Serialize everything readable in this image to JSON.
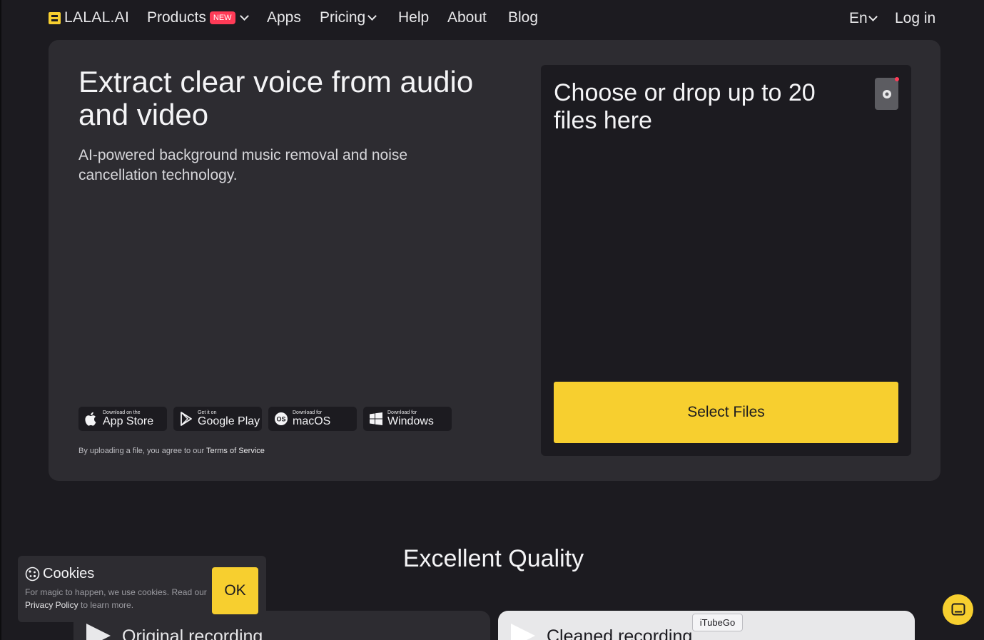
{
  "brand": {
    "name": "LALAL.AI"
  },
  "nav": {
    "products": "Products",
    "new_badge": "NEW",
    "apps": "Apps",
    "pricing": "Pricing",
    "help": "Help",
    "about": "About",
    "blog": "Blog",
    "language": "En",
    "login": "Log in"
  },
  "hero": {
    "title": "Extract clear voice from audio and video",
    "subtitle": "AI-powered background music removal and noise cancellation technology.",
    "stores": [
      {
        "small": "Download on the",
        "big": "App Store",
        "icon": "apple-icon"
      },
      {
        "small": "Get it on",
        "big": "Google Play",
        "icon": "google-play-icon"
      },
      {
        "small": "Download for",
        "big": "macOS",
        "icon": "macos-icon"
      },
      {
        "small": "Download for",
        "big": "Windows",
        "icon": "windows-icon"
      }
    ],
    "terms_prefix": "By uploading a file, you agree to our ",
    "terms_link": "Terms of Service"
  },
  "dropzone": {
    "title": "Choose or drop up to 20 files here",
    "select_button": "Select Files"
  },
  "quality": {
    "heading": "Excellent Quality",
    "original_label": "Original recording",
    "cleaned_label": "Cleaned recording",
    "tooltip": "iTubeGo"
  },
  "cookies": {
    "title": "Cookies",
    "text_prefix": "For magic to happen, we use cookies. Read our ",
    "policy_link": "Privacy Policy",
    "text_suffix": " to learn more.",
    "ok_button": "OK"
  },
  "colors": {
    "accent": "#f7cf2f",
    "background": "#1c1b20",
    "panel": "#2d2c31",
    "badge": "#ff3b57"
  }
}
